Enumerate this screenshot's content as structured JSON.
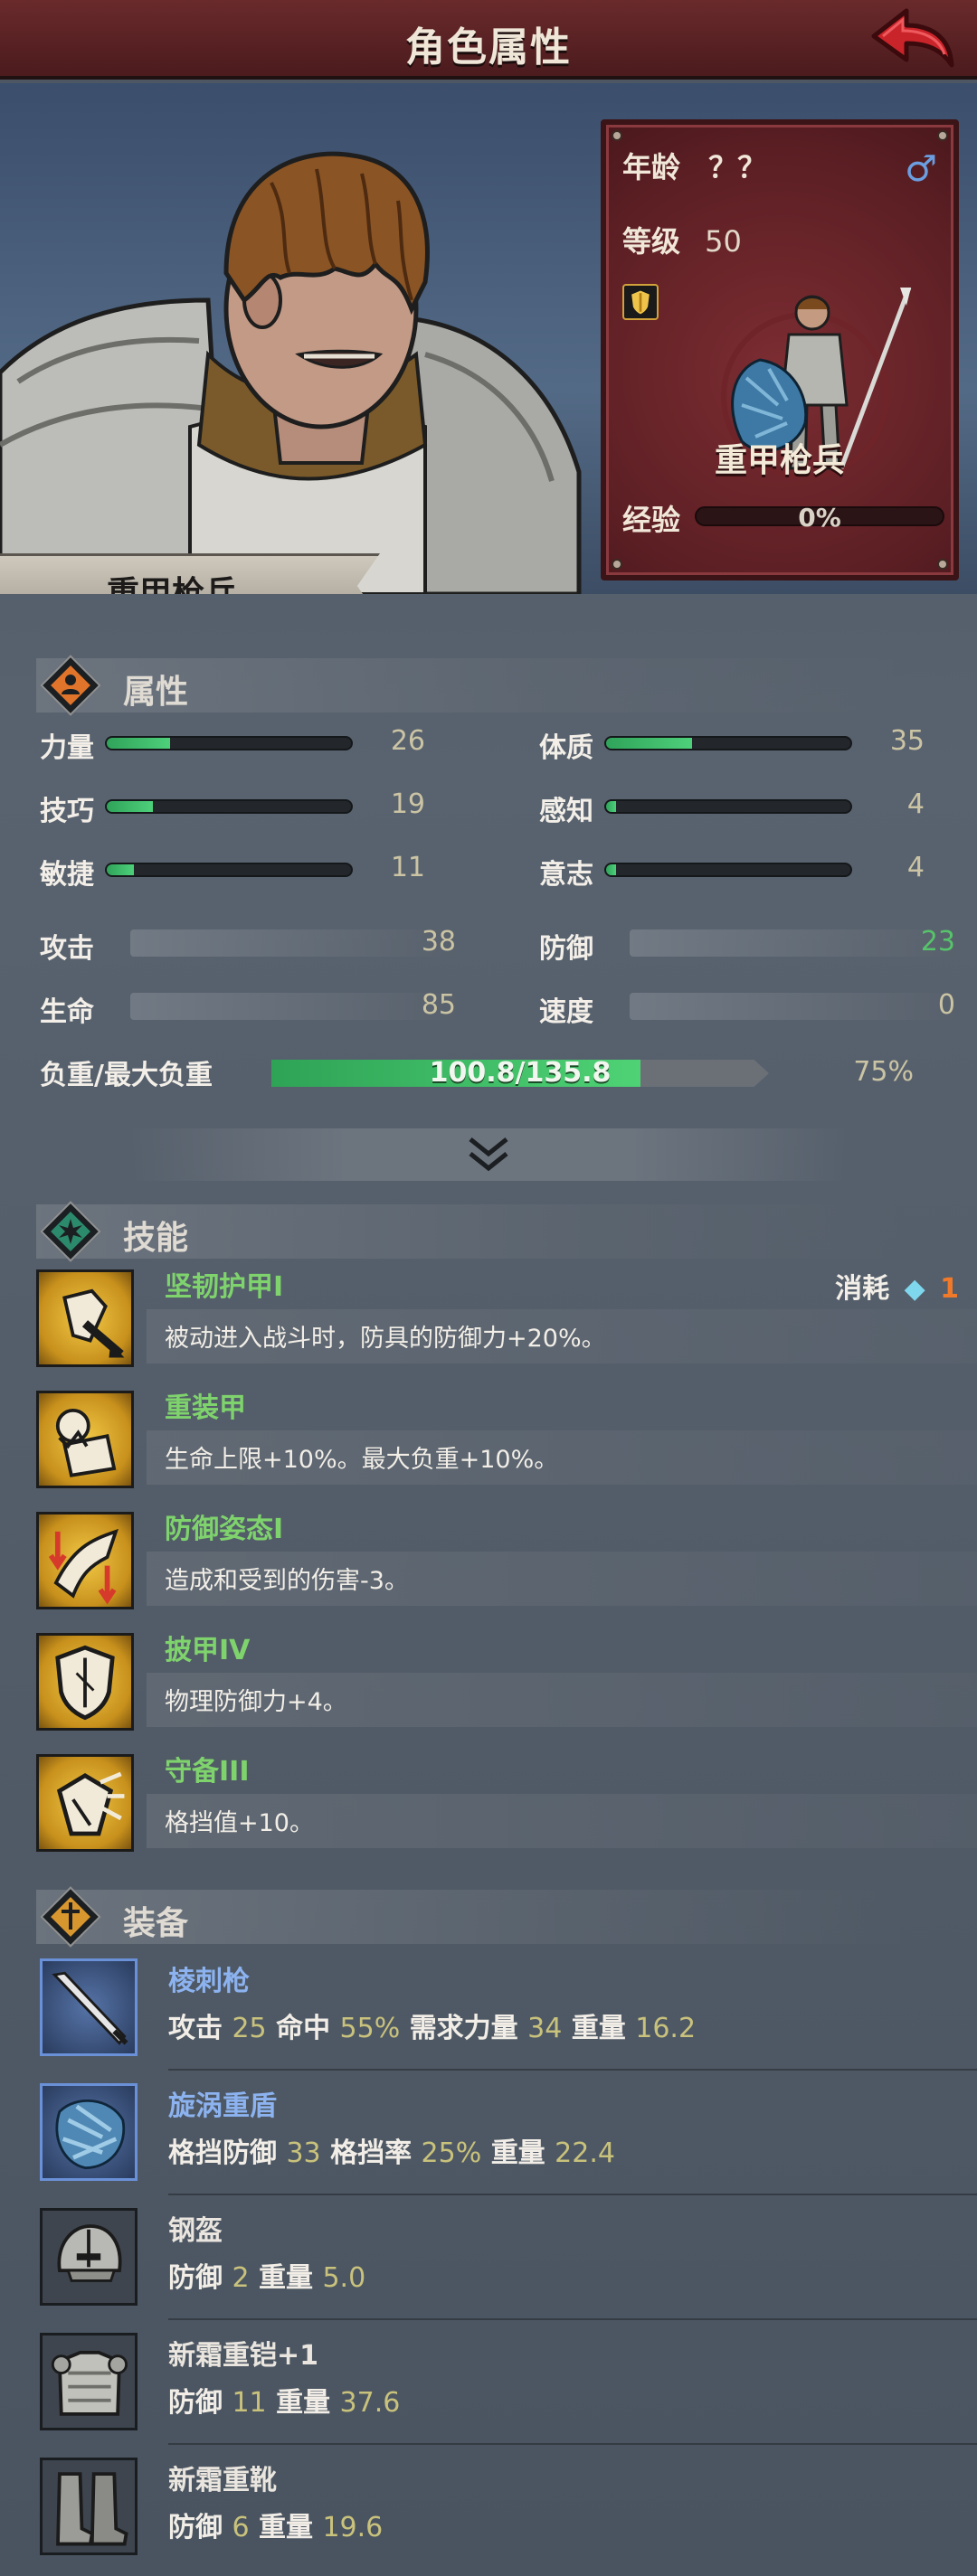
{
  "header": {
    "title": "角色属性"
  },
  "hero": {
    "unit_name": "重甲枪兵"
  },
  "info_card": {
    "age_label": "年龄",
    "age_value": "？？",
    "gender_symbol": "♂",
    "level_label": "等级",
    "level_value": "50",
    "class_name": "重甲枪兵",
    "exp_label": "经验",
    "exp_value": "0%"
  },
  "attributes": {
    "title": "属性",
    "primary": [
      {
        "label": "力量",
        "value": "26",
        "fill": 0.26
      },
      {
        "label": "体质",
        "value": "35",
        "fill": 0.35
      },
      {
        "label": "技巧",
        "value": "19",
        "fill": 0.19
      },
      {
        "label": "感知",
        "value": "4",
        "fill": 0.04
      },
      {
        "label": "敏捷",
        "value": "11",
        "fill": 0.11
      },
      {
        "label": "意志",
        "value": "4",
        "fill": 0.04
      }
    ],
    "derived": [
      {
        "label": "攻击",
        "value": "38",
        "color": "#cbc4a4"
      },
      {
        "label": "防御",
        "value": "23",
        "color": "#56c46a"
      },
      {
        "label": "生命",
        "value": "85",
        "color": "#cbc4a4"
      },
      {
        "label": "速度",
        "value": "0",
        "color": "#cbc4a4"
      }
    ],
    "load_label": "负重/最大负重",
    "load_value": "100.8/135.8",
    "load_fill": 0.742,
    "load_percent": "75%"
  },
  "skills": {
    "title": "技能",
    "cost_label": "消耗",
    "cost_value": "1",
    "items": [
      {
        "name": "坚韧护甲I",
        "desc": "被动进入战斗时，防具的防御力+20%。"
      },
      {
        "name": "重装甲",
        "desc": "生命上限+10%。最大负重+10%。"
      },
      {
        "name": "防御姿态I",
        "desc": "造成和受到的伤害-3。"
      },
      {
        "name": "披甲IV",
        "desc": "物理防御力+4。"
      },
      {
        "name": "守备III",
        "desc": "格挡值+10。"
      }
    ]
  },
  "equipment": {
    "title": "装备",
    "items": [
      {
        "name": "棱刺枪",
        "rare": true,
        "stats": [
          [
            "攻击",
            "25"
          ],
          [
            "命中",
            "55%"
          ],
          [
            "需求力量",
            "34"
          ],
          [
            "重量",
            "16.2"
          ]
        ]
      },
      {
        "name": "旋涡重盾",
        "rare": true,
        "stats": [
          [
            "格挡防御",
            "33"
          ],
          [
            "格挡率",
            "25%"
          ],
          [
            "重量",
            "22.4"
          ]
        ]
      },
      {
        "name": "钢盔",
        "rare": false,
        "stats": [
          [
            "防御",
            "2"
          ],
          [
            "重量",
            "5.0"
          ]
        ]
      },
      {
        "name": "新霜重铠+1",
        "rare": false,
        "stats": [
          [
            "防御",
            "11"
          ],
          [
            "重量",
            "37.6"
          ]
        ]
      },
      {
        "name": "新霜重靴",
        "rare": false,
        "stats": [
          [
            "防御",
            "6"
          ],
          [
            "重量",
            "19.6"
          ]
        ]
      }
    ]
  }
}
